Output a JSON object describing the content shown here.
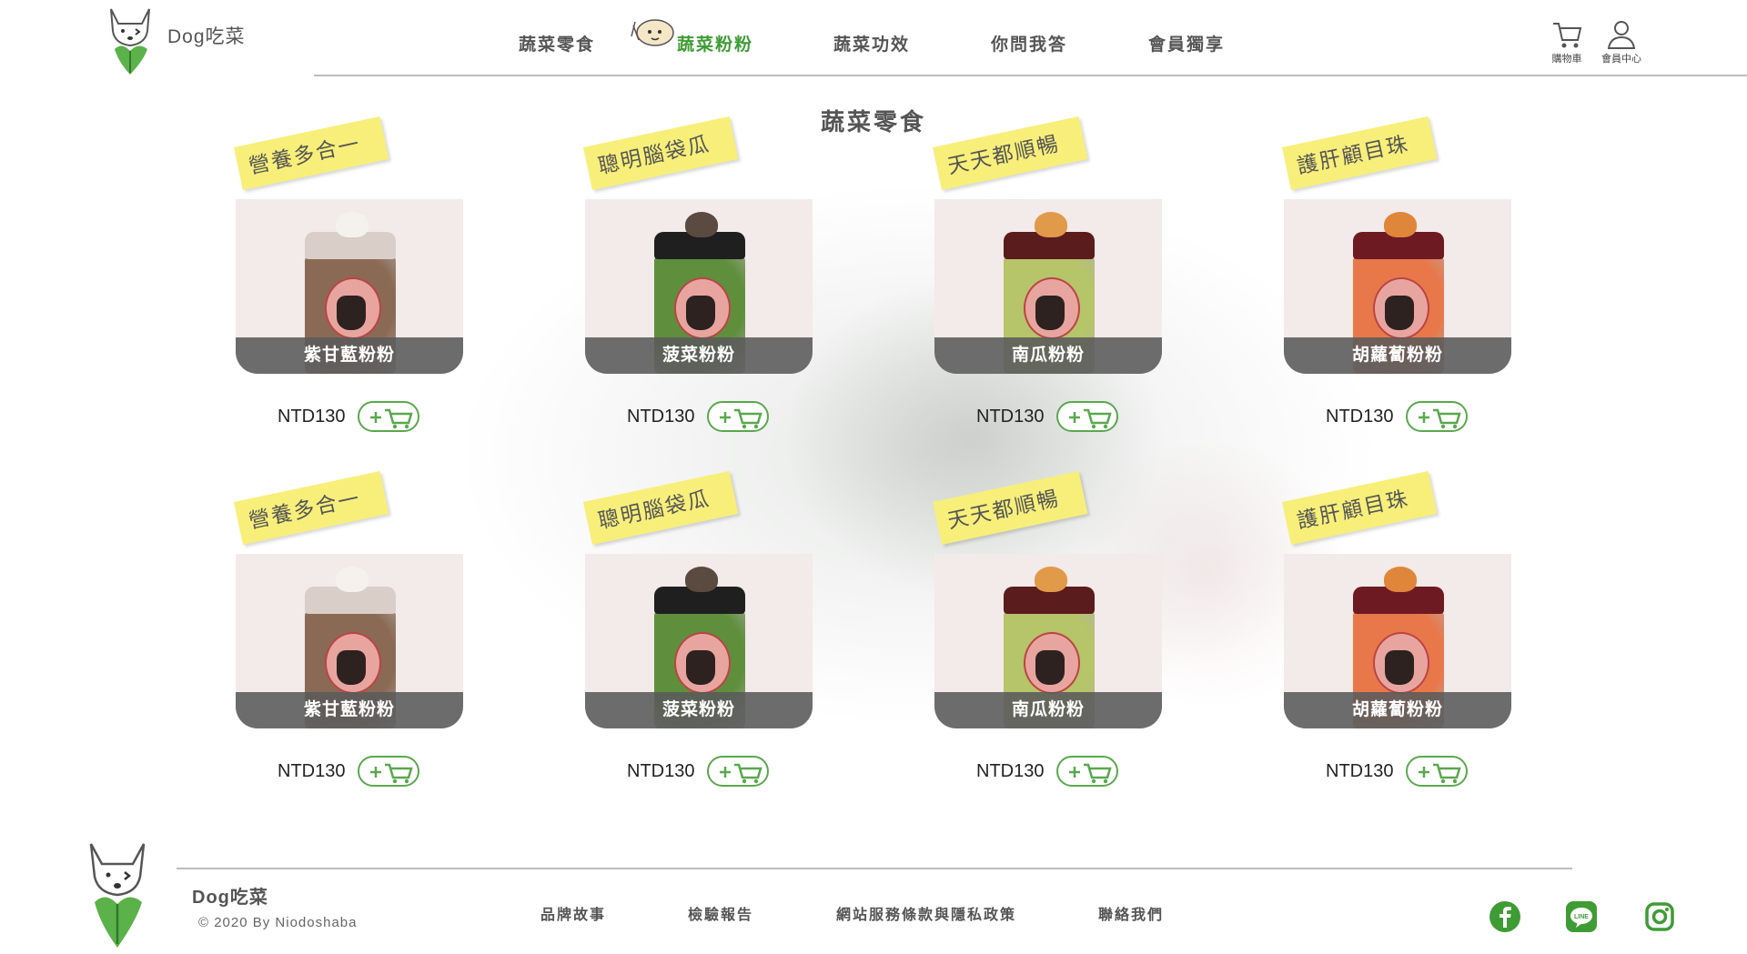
{
  "brand": {
    "name": "Dog吃菜"
  },
  "nav": {
    "items": [
      {
        "label": "蔬菜零食",
        "active": false
      },
      {
        "label": "蔬菜粉粉",
        "active": true
      },
      {
        "label": "蔬菜功效",
        "active": false
      },
      {
        "label": "你問我答",
        "active": false
      },
      {
        "label": "會員獨享",
        "active": false
      }
    ]
  },
  "tools": {
    "cart_label": "購物車",
    "member_label": "會員中心"
  },
  "section": {
    "title": "蔬菜零食"
  },
  "products": [
    {
      "tag": "營養多合一",
      "name": "紫甘藍粉粉",
      "price": "NTD130",
      "jar_color": "#8a6a55",
      "lid_color": "#d9cfc8",
      "cat_color": "#f5f2ee"
    },
    {
      "tag": "聰明腦袋瓜",
      "name": "菠菜粉粉",
      "price": "NTD130",
      "jar_color": "#5f8f3c",
      "lid_color": "#1f1f1f",
      "cat_color": "#5a4a40"
    },
    {
      "tag": "天天都順暢",
      "name": "南瓜粉粉",
      "price": "NTD130",
      "jar_color": "#b6c46a",
      "lid_color": "#5a1c1c",
      "cat_color": "#e09a4a"
    },
    {
      "tag": "護肝顧目珠",
      "name": "胡蘿蔔粉粉",
      "price": "NTD130",
      "jar_color": "#e8784a",
      "lid_color": "#6e1a22",
      "cat_color": "#e0863a"
    },
    {
      "tag": "營養多合一",
      "name": "紫甘藍粉粉",
      "price": "NTD130",
      "jar_color": "#8a6a55",
      "lid_color": "#d9cfc8",
      "cat_color": "#f5f2ee"
    },
    {
      "tag": "聰明腦袋瓜",
      "name": "菠菜粉粉",
      "price": "NTD130",
      "jar_color": "#5f8f3c",
      "lid_color": "#1f1f1f",
      "cat_color": "#5a4a40"
    },
    {
      "tag": "天天都順暢",
      "name": "南瓜粉粉",
      "price": "NTD130",
      "jar_color": "#b6c46a",
      "lid_color": "#5a1c1c",
      "cat_color": "#e09a4a"
    },
    {
      "tag": "護肝顧目珠",
      "name": "胡蘿蔔粉粉",
      "price": "NTD130",
      "jar_color": "#e8784a",
      "lid_color": "#6e1a22",
      "cat_color": "#e0863a"
    }
  ],
  "footer": {
    "brand": "Dog吃菜",
    "copyright": "© 2020 By Niodoshaba",
    "links": [
      "品牌故事",
      "檢驗報告",
      "網站服務條款與隱私政策",
      "聯絡我們"
    ]
  },
  "colors": {
    "accent": "#3f9c35",
    "ribbon": "#f7ef7a",
    "cart_border": "#5aa84e"
  },
  "icons": {
    "cart": "cart-icon",
    "member": "user-icon",
    "social": [
      "facebook-icon",
      "line-icon",
      "instagram-icon"
    ]
  }
}
